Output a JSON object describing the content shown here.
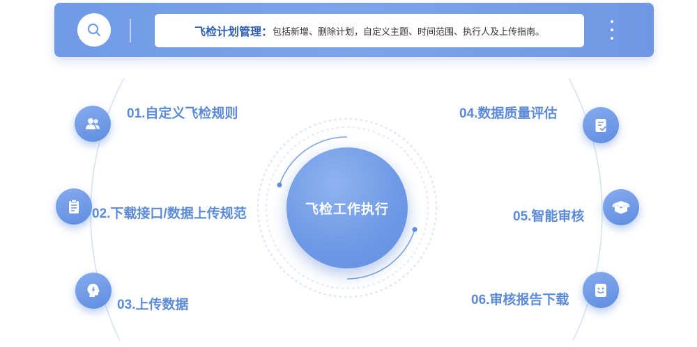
{
  "header": {
    "search_icon": "search-icon",
    "title": "飞检计划管理",
    "separator": "：",
    "description": "包括新增、删除计划，自定义主题、时间范围、执行人及上传指南。",
    "more_icon": "vertical-ellipsis-icon"
  },
  "diagram": {
    "center": {
      "label": "飞检工作执行"
    },
    "steps": [
      {
        "label": "01.自定义飞检规则",
        "icon": "users-icon"
      },
      {
        "label": "02.下载接口/数据上传规范",
        "icon": "clipboard-icon"
      },
      {
        "label": "03.上传数据",
        "icon": "head-idea-icon"
      },
      {
        "label": "04.数据质量评估",
        "icon": "checklist-icon"
      },
      {
        "label": "05.智能审核",
        "icon": "box-icon"
      },
      {
        "label": "06.审核报告下载",
        "icon": "report-icon"
      }
    ]
  },
  "colors": {
    "accent": "#6f9ae6",
    "accent_dark": "#2e5fb8",
    "label": "#5b8ad9"
  }
}
